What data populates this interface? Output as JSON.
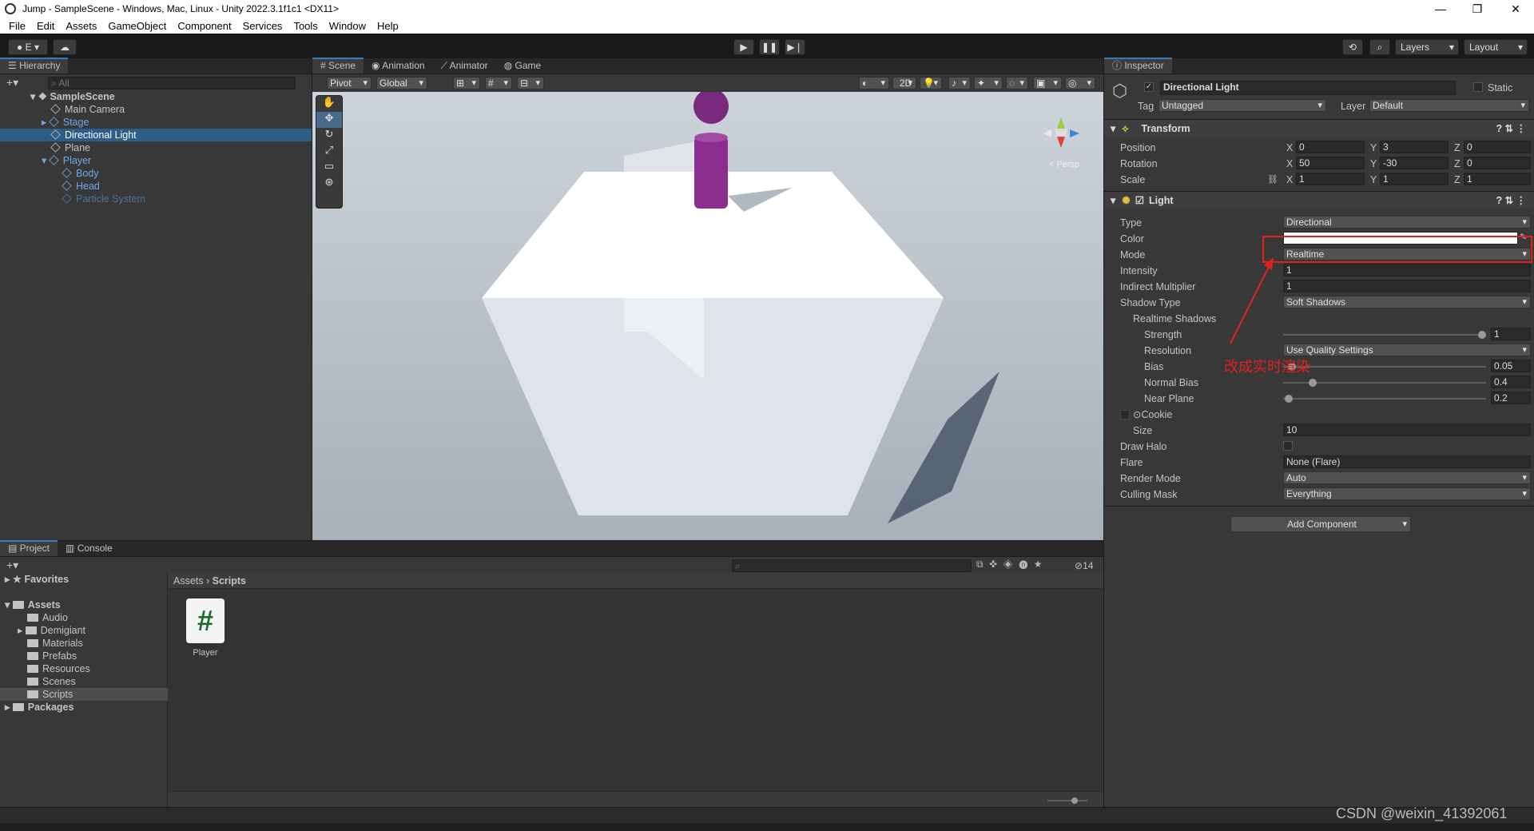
{
  "window": {
    "title": "Jump - SampleScene - Windows, Mac, Linux - Unity 2022.3.1f1c1 <DX11>",
    "minimize": "—",
    "maximize": "❐",
    "close": "✕"
  },
  "menu": [
    "File",
    "Edit",
    "Assets",
    "GameObject",
    "Component",
    "Services",
    "Tools",
    "Window",
    "Help"
  ],
  "toolbar": {
    "account_label": "E",
    "play": "▶",
    "pause": "❚❚",
    "step": "▶❘",
    "layers_label": "Layers",
    "layout_label": "Layout"
  },
  "hierarchy": {
    "tab": "Hierarchy",
    "search_placeholder": "All",
    "scene": "SampleScene",
    "items": [
      {
        "label": "Main Camera",
        "color": "#c4c4c4"
      },
      {
        "label": "Stage",
        "color": "#6fa9e8"
      },
      {
        "label": "Directional Light",
        "color": "#ffffff"
      },
      {
        "label": "Plane",
        "color": "#c4c4c4"
      },
      {
        "label": "Player",
        "color": "#6fa9e8"
      },
      {
        "label": "Body",
        "color": "#6fa9e8"
      },
      {
        "label": "Head",
        "color": "#6fa9e8"
      },
      {
        "label": "Particle System",
        "color": "#50739a"
      }
    ]
  },
  "scene_tabs": [
    "Scene",
    "Animation",
    "Animator",
    "Game"
  ],
  "scene_toolbar": {
    "pivot": "Pivot",
    "global": "Global",
    "two_d": "2D",
    "persp": "< Persp"
  },
  "inspector": {
    "tab": "Inspector",
    "object_name": "Directional Light",
    "static_label": "Static",
    "tag_label": "Tag",
    "tag_value": "Untagged",
    "layer_label": "Layer",
    "layer_value": "Default",
    "transform": {
      "title": "Transform",
      "position_label": "Position",
      "rotation_label": "Rotation",
      "scale_label": "Scale",
      "position": [
        "0",
        "3",
        "0"
      ],
      "rotation": [
        "50",
        "-30",
        "0"
      ],
      "scale": [
        "1",
        "1",
        "1"
      ]
    },
    "light": {
      "title": "Light",
      "type_label": "Type",
      "type": "Directional",
      "color_label": "Color",
      "mode_label": "Mode",
      "mode": "Realtime",
      "intensity_label": "Intensity",
      "intensity": "1",
      "indirect_label": "Indirect Multiplier",
      "indirect": "1",
      "shadow_type_label": "Shadow Type",
      "shadow_type": "Soft Shadows",
      "realtime_shadows_label": "Realtime Shadows",
      "strength_label": "Strength",
      "strength": "1",
      "resolution_label": "Resolution",
      "resolution": "Use Quality Settings",
      "bias_label": "Bias",
      "bias": "0.05",
      "normal_bias_label": "Normal Bias",
      "normal_bias": "0.4",
      "near_plane_label": "Near Plane",
      "near_plane": "0.2",
      "cookie_label": "Cookie",
      "size_label": "Size",
      "size": "10",
      "draw_halo_label": "Draw Halo",
      "flare_label": "Flare",
      "flare": "None (Flare)",
      "render_mode_label": "Render Mode",
      "render_mode": "Auto",
      "culling_label": "Culling Mask",
      "culling": "Everything"
    },
    "add_component": "Add Component",
    "annotation": "改成实时渲染"
  },
  "project": {
    "tabs": [
      "Project",
      "Console"
    ],
    "favorites": "Favorites",
    "assets": "Assets",
    "folders": [
      "Audio",
      "Demigiant",
      "Materials",
      "Prefabs",
      "Resources",
      "Scenes",
      "Scripts"
    ],
    "packages": "Packages",
    "breadcrumb": [
      "Assets",
      "Scripts"
    ],
    "file_name": "Player",
    "file_glyph": "#",
    "hidden_count": "14"
  },
  "watermark": "CSDN @weixin_41392061"
}
